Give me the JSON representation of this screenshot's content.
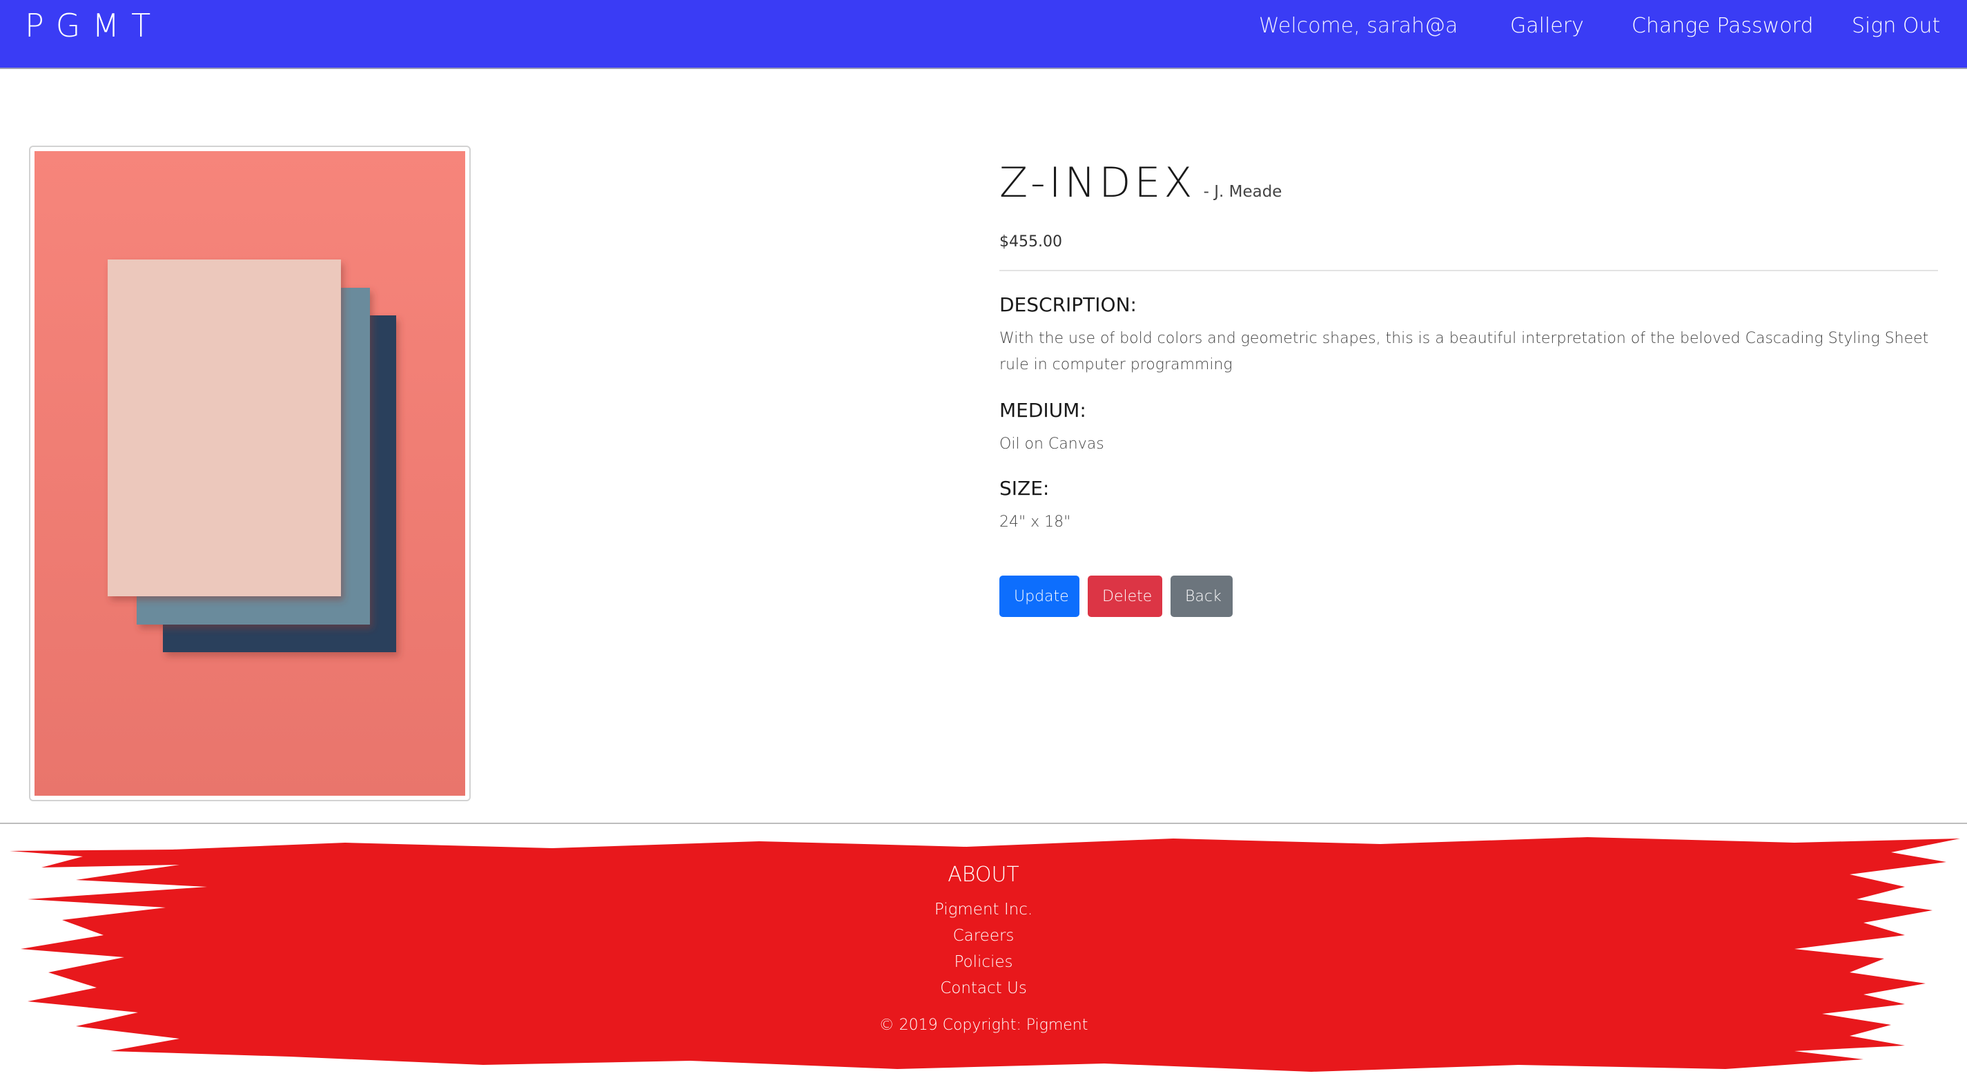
{
  "nav": {
    "brand": "PGMT",
    "welcome": "Welcome, sarah@a",
    "gallery": "Gallery",
    "change_password": "Change Password",
    "sign_out": "Sign Out",
    "bar_color": "#3a3cf5"
  },
  "artwork": {
    "title": "Z-INDEX",
    "artist": "- J. Meade",
    "price": "$455.00",
    "description_label": "DESCRIPTION:",
    "description": "With the use of bold colors and geometric shapes, this is a beautiful interpretation of the beloved Cascading Styling Sheet rule in computer programming",
    "medium_label": "MEDIUM:",
    "medium": "Oil on Canvas",
    "size_label": "SIZE:",
    "size": "24\" x 18\"",
    "image_colors": {
      "background": "#f58077",
      "sheet_front": "#ecc8bc",
      "sheet_middle": "#6a8b9c",
      "sheet_back": "#2c3f5b"
    }
  },
  "actions": {
    "update": "Update",
    "delete": "Delete",
    "back": "Back"
  },
  "footer": {
    "heading": "ABOUT",
    "links": [
      "Pigment Inc.",
      "Careers",
      "Policies",
      "Contact Us"
    ],
    "copyright": "© 2019 Copyright: Pigment",
    "paint_color": "#e8181c"
  }
}
